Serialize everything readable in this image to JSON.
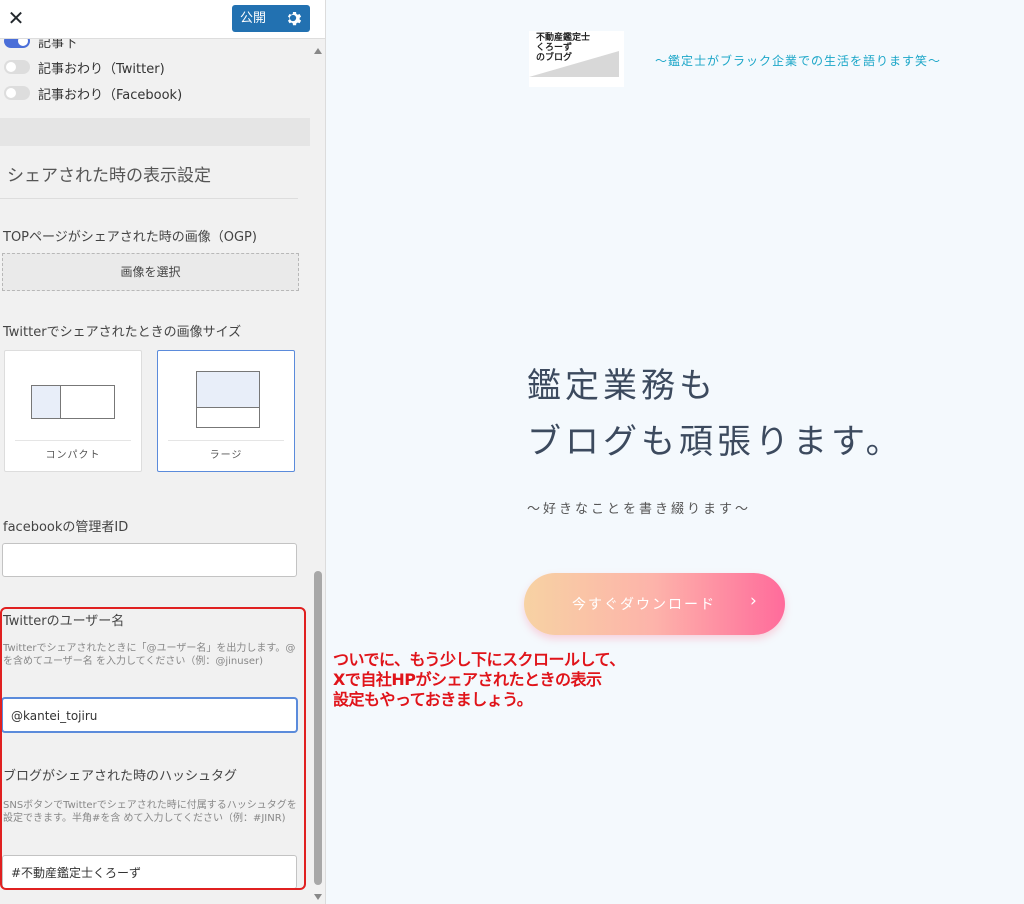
{
  "header": {
    "close_icon": "close-icon",
    "publish_label": "公開",
    "settings_icon": "gear-icon",
    "accent": "#2271b1"
  },
  "toggles": [
    {
      "label": "記事下",
      "on": true
    },
    {
      "label": "記事おわり（Twitter)",
      "on": false
    },
    {
      "label": "記事おわり（Facebook)",
      "on": false
    }
  ],
  "share_settings": {
    "section_title": "シェアされた時の表示設定",
    "ogp_label": "TOPページがシェアされた時の画像（OGP)",
    "select_image_button": "画像を選択",
    "twitter_size_label": "Twitterでシェアされたときの画像サイズ",
    "card_options": [
      {
        "label": "コンパクト",
        "selected": false
      },
      {
        "label": "ラージ",
        "selected": true
      }
    ],
    "facebook_admin_label": "facebookの管理者ID",
    "facebook_admin_value": "",
    "twitter_username_label": "Twitterのユーザー名",
    "twitter_username_desc": "Twitterでシェアされたときに「@ユーザー名」を出力します。@を含めてユーザー名 を入力してください（例：@jinuser)",
    "twitter_username_value": "@kantei_tojiru",
    "hashtag_label": "ブログがシェアされた時のハッシュタグ",
    "hashtag_desc": "SNSボタンでTwitterでシェアされた時に付属するハッシュタグを設定できます。半角#を含 めて入力してください（例：#JINR)",
    "hashtag_value": "#不動産鑑定士くろーず"
  },
  "preview": {
    "logo_lines": [
      "不動産鑑定士",
      "くろーず",
      "のブログ"
    ],
    "tagline": "〜鑑定士がブラック企業での生活を語ります笑〜",
    "hero_line1": "鑑定業務も",
    "hero_line2": "ブログも頑張ります。",
    "hero_sub": "〜好きなことを書き綴ります〜",
    "cta_label": "今すぐダウンロード",
    "cta_icon": "chevron-right-icon"
  },
  "annotation": {
    "line1": "ついでに、もう少し下にスクロールして、",
    "line2": "Xで自社HPがシェアされたときの表示",
    "line3": "設定もやっておきましょう。",
    "color": "#e0141a"
  }
}
